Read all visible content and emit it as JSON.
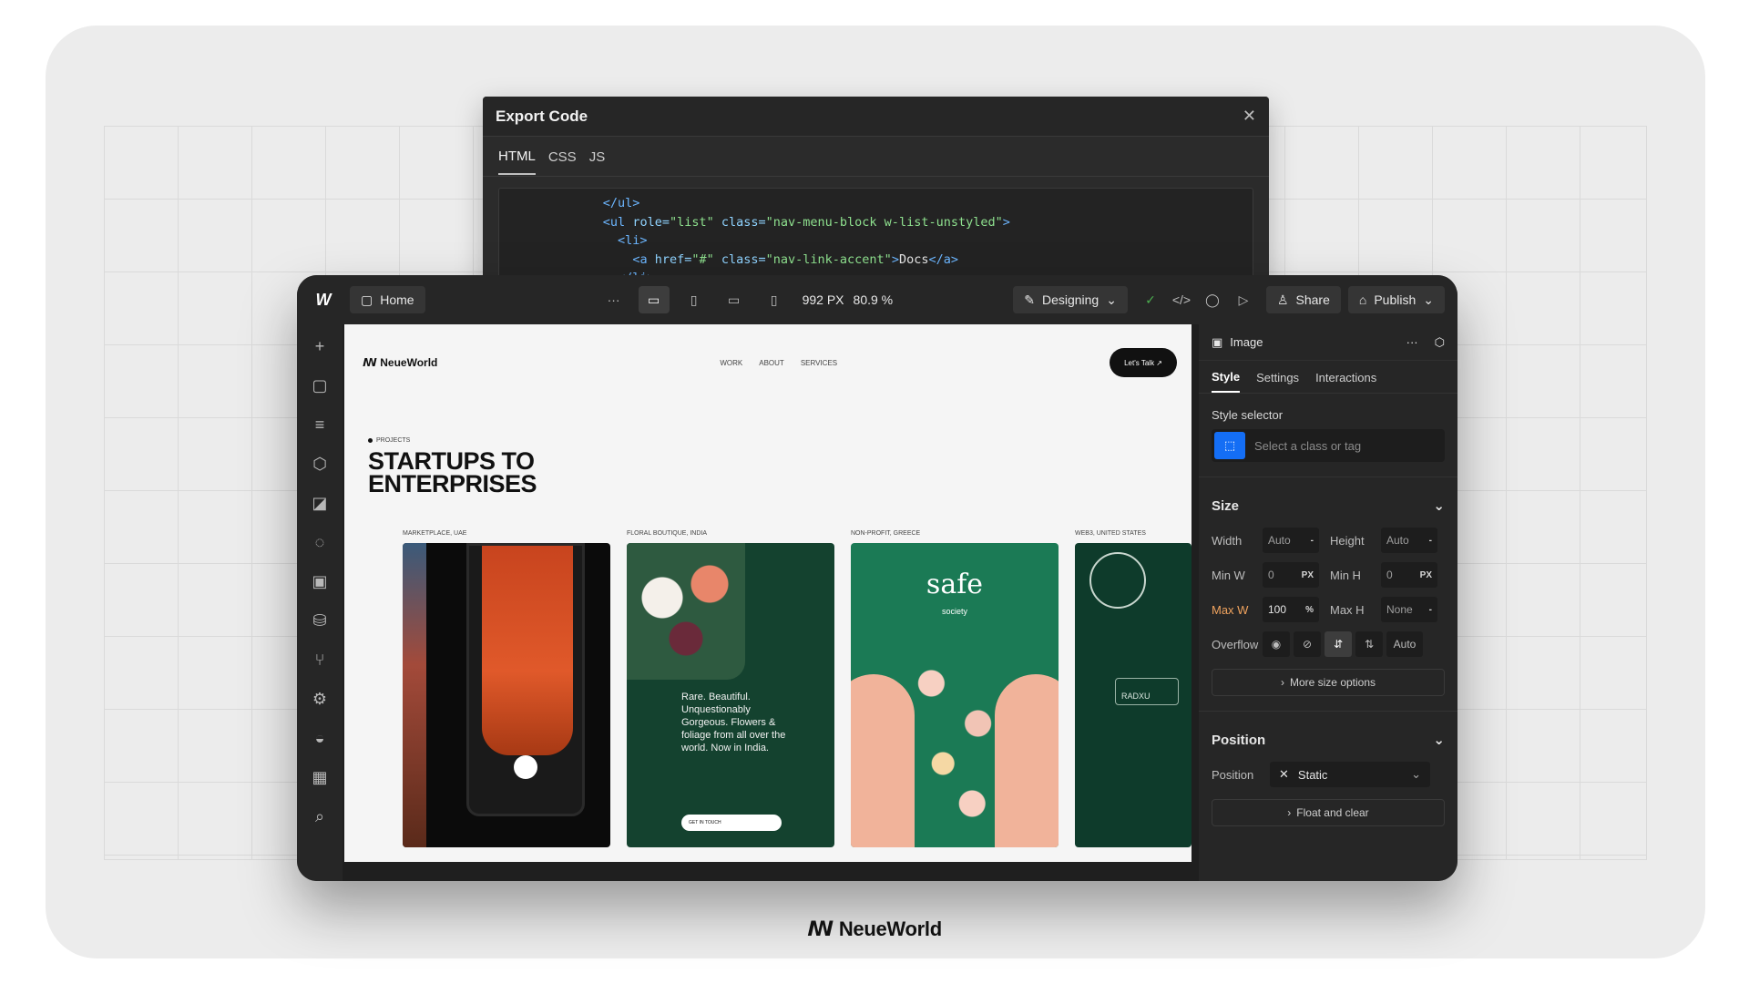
{
  "export": {
    "title": "Export Code",
    "tabs": [
      "HTML",
      "CSS",
      "JS"
    ],
    "code": {
      "l1_tag": "</ul>",
      "l2_open": "<ul ",
      "l2_attr1": "role=",
      "l2_val1": "\"list\"",
      "l2_attr2": " class=",
      "l2_val2": "\"nav-menu-block w-list-unstyled\"",
      "l2_close": ">",
      "l3_tag": "<li>",
      "l4_open": "<a ",
      "l4_attr1": "href=",
      "l4_val1": "\"#\"",
      "l4_attr2": " class=",
      "l4_val2": "\"nav-link-accent\"",
      "l4_close": ">",
      "l4_text": "Docs",
      "l4_end": "</a>",
      "l5_tag": "</li>"
    }
  },
  "topbar": {
    "home": "Home",
    "more": "···",
    "px": "992 PX",
    "zoom": "80.9 %",
    "mode": "Designing",
    "share": "Share",
    "publish": "Publish"
  },
  "site": {
    "logo": "ꟿ NeueWorld",
    "links": [
      "WORK",
      "ABOUT",
      "SERVICES"
    ],
    "cta": "Let's Talk ↗",
    "eyebrow": "PROJECTS",
    "hero": "STARTUPS TO ENTERPRISES",
    "captions": [
      "MARKETPLACE, UAE",
      "FLORAL BOUTIQUE, INDIA",
      "NON-PROFIT, GREECE",
      "WEB3, UNITED STATES"
    ],
    "p2_copy": "Rare. Beautiful. Unquestionably Gorgeous. Flowers & foliage from all over the world. Now in India.",
    "p2_cta": "GET IN TOUCH",
    "p3_brand": "safe",
    "p3_sub": "society",
    "p4_brand": "RADXU"
  },
  "panel": {
    "title": "Image",
    "tabs": [
      "Style",
      "Settings",
      "Interactions"
    ],
    "style_selector": "Style selector",
    "selector_placeholder": "Select a class or tag",
    "size_title": "Size",
    "width_label": "Width",
    "width_val": "Auto",
    "height_label": "Height",
    "height_val": "Auto",
    "minw_label": "Min W",
    "minw_val": "0",
    "minw_unit": "PX",
    "minh_label": "Min H",
    "minh_val": "0",
    "minh_unit": "PX",
    "maxw_label": "Max W",
    "maxw_val": "100",
    "maxw_unit": "%",
    "maxh_label": "Max H",
    "maxh_val": "None",
    "overflow_label": "Overflow",
    "overflow_auto": "Auto",
    "more_size": "More size options",
    "position_title": "Position",
    "position_label": "Position",
    "position_val": "Static",
    "float_clear": "Float and clear"
  },
  "footer": {
    "brand": "ꟿ NeueWorld"
  },
  "colors": {
    "accent": "#146ef5",
    "warn": "#f0a35e",
    "success": "#4caf50"
  }
}
